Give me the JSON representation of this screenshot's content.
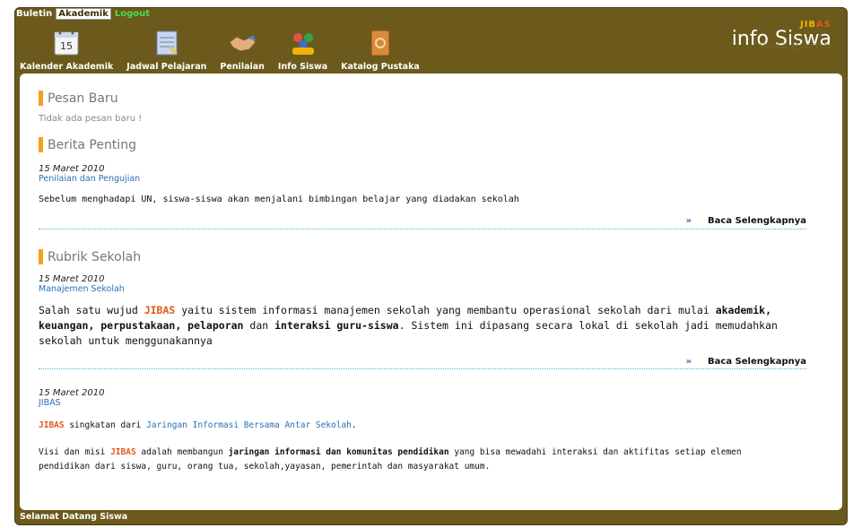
{
  "topnav": {
    "buletin": "Buletin",
    "akademik": "Akademik",
    "logout": "Logout"
  },
  "toolbar": [
    {
      "label": "Kalender Akademik",
      "icon": "calendar-icon",
      "day": "15"
    },
    {
      "label": "Jadwal Pelajaran",
      "icon": "schedule-notepad-icon"
    },
    {
      "label": "Penilaian",
      "icon": "handshake-icon"
    },
    {
      "label": "Info Siswa",
      "icon": "students-icon"
    },
    {
      "label": "Katalog Pustaka",
      "icon": "book-catalog-icon"
    }
  ],
  "brand": {
    "jib": "JIB",
    "as": "AS",
    "title": "info Siswa"
  },
  "pesan": {
    "title": "Pesan Baru",
    "empty": "Tidak ada pesan baru !"
  },
  "berita": {
    "title": "Berita Penting",
    "date": "15 Maret 2010",
    "category": "Penilaian dan Pengujian",
    "text": "Sebelum menghadapi UN, siswa-siswa akan menjalani bimbingan belajar yang diadakan sekolah",
    "read_more": "Baca Selengkapnya"
  },
  "rubrik": {
    "title": "Rubrik Sekolah",
    "date": "15 Maret 2010",
    "category": "Manajemen Sekolah",
    "t1": "Salah satu wujud ",
    "t2": "JIBAS",
    "t3": " yaitu sistem informasi manajemen sekolah yang membantu operasional sekolah dari mulai ",
    "t4": "akademik, keuangan, perpustakaan, pelaporan",
    "t5": " dan ",
    "t6": "interaksi guru-siswa",
    "t7": ". Sistem ini dipasang secara lokal di sekolah jadi memudahkan sekolah untuk menggunakannya",
    "read_more": "Baca Selengkapnya"
  },
  "jibas_article": {
    "date": "15 Maret 2010",
    "category": "JIBAS",
    "a1": "JIBAS",
    "a2": " singkatan dari ",
    "a3": "Jaringan Informasi Bersama Antar Sekolah",
    "a4": ".",
    "b1": "Visi dan misi ",
    "b2": "JIBAS",
    "b3": " adalah membangun ",
    "b4": "jaringan informasi dan komunitas pendidikan",
    "b5": " yang bisa mewadahi interaksi dan aktifitas setiap elemen pendidikan dari siswa, guru, orang tua, sekolah,yayasan, pemerintah dan masyarakat umum."
  },
  "footer": {
    "text": "Selamat Datang Siswa"
  },
  "colors": {
    "frame": "#6b5a1c",
    "accent": "#f5a020",
    "link": "#2a6fb5",
    "jibas": "#e05a18"
  }
}
